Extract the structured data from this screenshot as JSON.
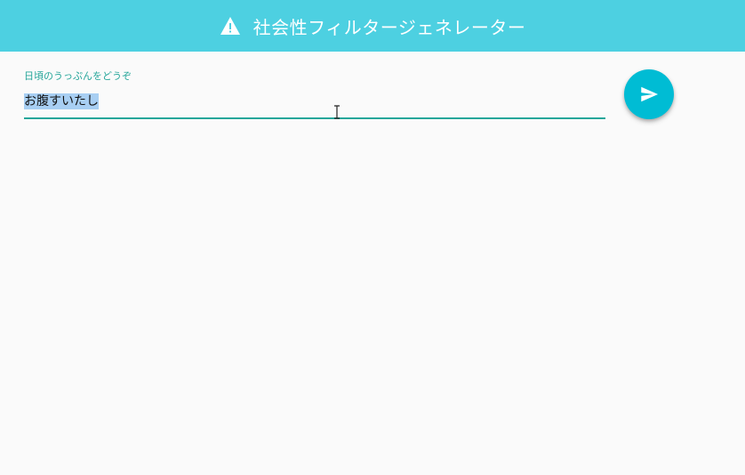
{
  "header": {
    "title": "社会性フィルタージェネレーター",
    "icon": "warning-icon"
  },
  "input": {
    "label": "日頃のうっぷんをどうぞ",
    "value": "お腹すいたし",
    "selected": true
  },
  "submit": {
    "icon": "send-icon"
  },
  "colors": {
    "header_bg": "#4dd0e1",
    "accent": "#26a69a",
    "fab_bg": "#00bcd4",
    "selection": "#a8cff3",
    "background": "#fafafa"
  }
}
